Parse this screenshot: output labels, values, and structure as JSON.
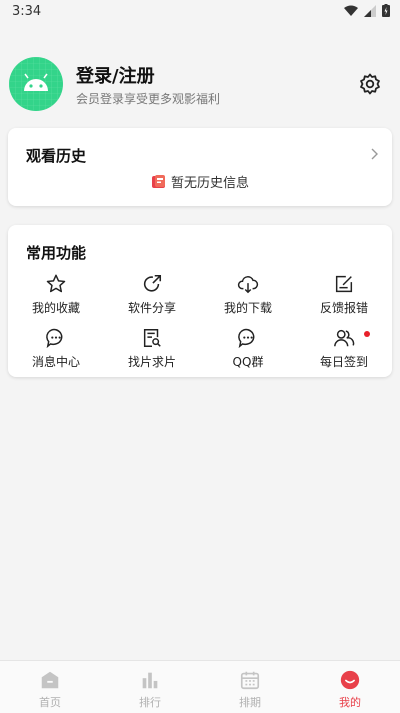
{
  "status": {
    "time": "3:34"
  },
  "profile": {
    "title": "登录/注册",
    "subtitle": "会员登录享受更多观影福利"
  },
  "history": {
    "title": "观看历史",
    "empty": "暂无历史信息"
  },
  "functions": {
    "title": "常用功能",
    "items": [
      {
        "label": "我的收藏",
        "icon": "star-icon"
      },
      {
        "label": "软件分享",
        "icon": "share-icon"
      },
      {
        "label": "我的下载",
        "icon": "cloud-download-icon"
      },
      {
        "label": "反馈报错",
        "icon": "feedback-icon"
      },
      {
        "label": "消息中心",
        "icon": "message-icon"
      },
      {
        "label": "找片求片",
        "icon": "search-file-icon"
      },
      {
        "label": "QQ群",
        "icon": "chat-icon"
      },
      {
        "label": "每日签到",
        "icon": "users-icon"
      }
    ]
  },
  "tabs": [
    {
      "label": "首页",
      "icon": "home-icon"
    },
    {
      "label": "排行",
      "icon": "bar-chart-icon"
    },
    {
      "label": "排期",
      "icon": "calendar-icon"
    },
    {
      "label": "我的",
      "icon": "smile-icon"
    }
  ],
  "colors": {
    "accent": "#e8404a",
    "avatar": "#33d48a",
    "badge": "#e8202a"
  }
}
